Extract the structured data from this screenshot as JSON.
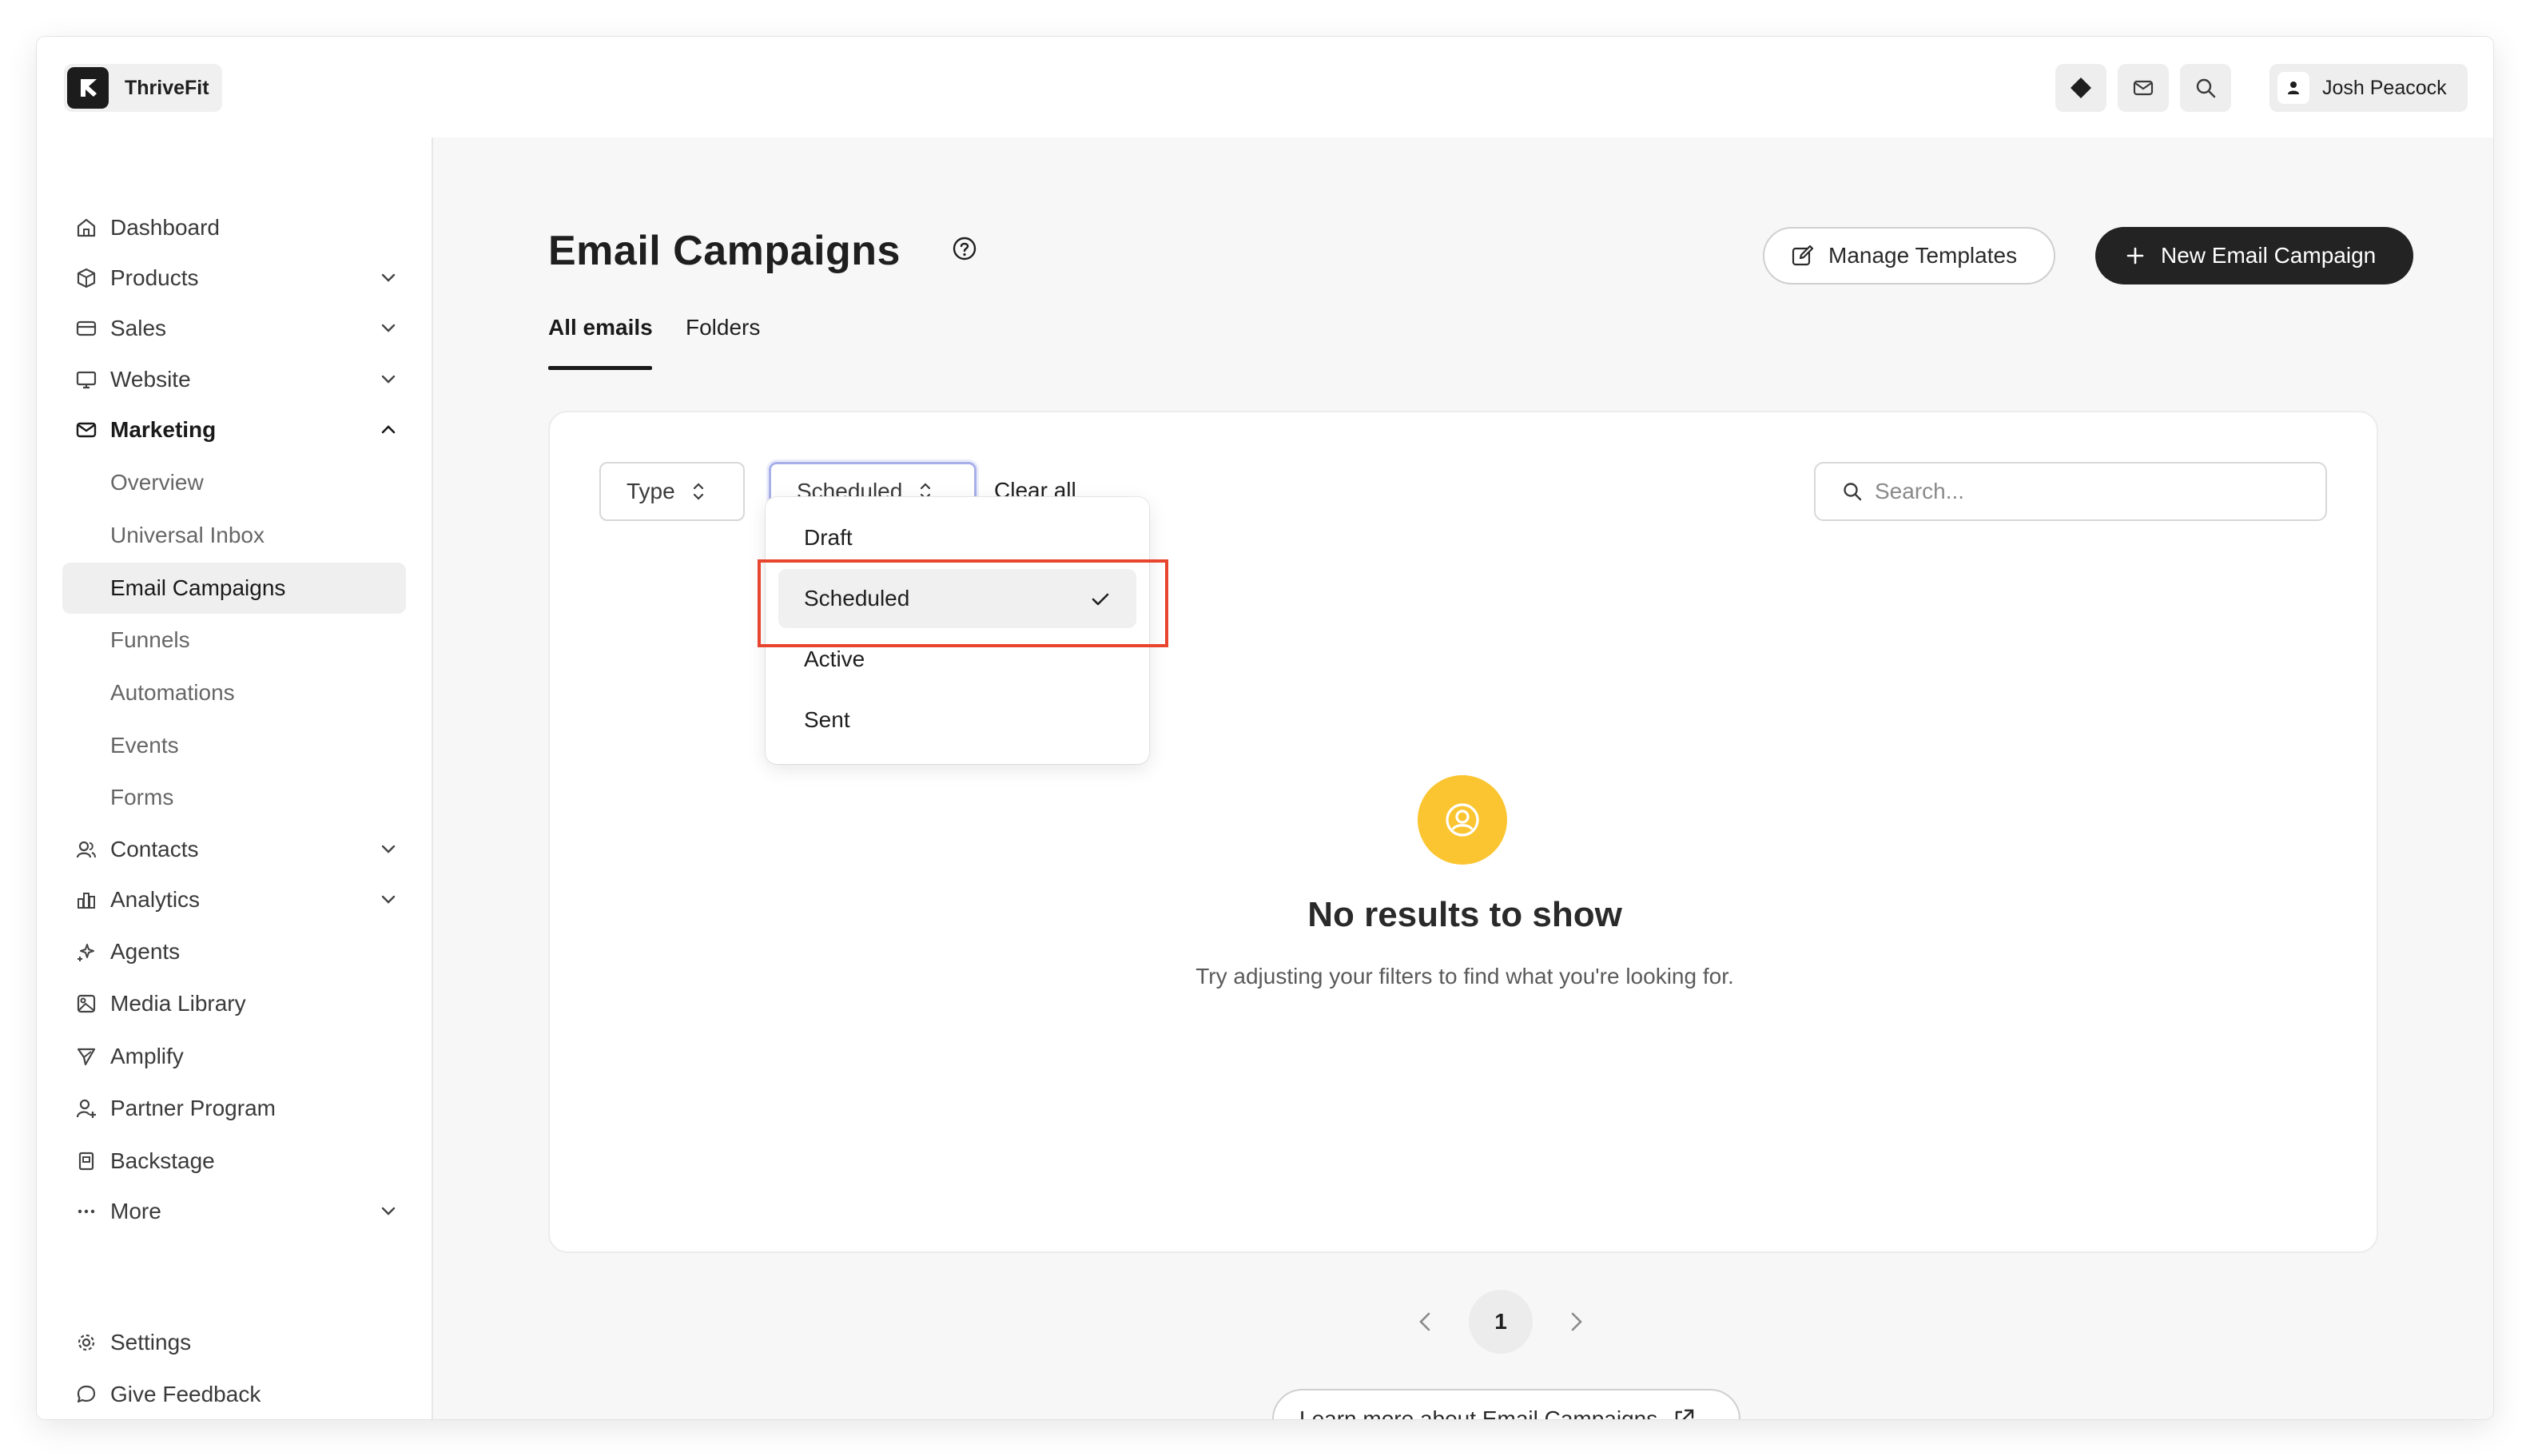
{
  "app": {
    "name": "ThriveFit"
  },
  "header": {
    "user_name": "Josh Peacock"
  },
  "sidebar": {
    "items": [
      {
        "label": "Dashboard"
      },
      {
        "label": "Products"
      },
      {
        "label": "Sales"
      },
      {
        "label": "Website"
      },
      {
        "label": "Marketing"
      },
      {
        "label": "Contacts"
      },
      {
        "label": "Analytics"
      },
      {
        "label": "Agents"
      },
      {
        "label": "Media Library"
      },
      {
        "label": "Amplify"
      },
      {
        "label": "Partner Program"
      },
      {
        "label": "Backstage"
      },
      {
        "label": "More"
      },
      {
        "label": "Settings"
      },
      {
        "label": "Give Feedback"
      }
    ],
    "marketing_sub": [
      {
        "label": "Overview"
      },
      {
        "label": "Universal Inbox"
      },
      {
        "label": "Email Campaigns"
      },
      {
        "label": "Funnels"
      },
      {
        "label": "Automations"
      },
      {
        "label": "Events"
      },
      {
        "label": "Forms"
      }
    ]
  },
  "page": {
    "title": "Email Campaigns",
    "manage_templates": "Manage Templates",
    "new_campaign": "New Email Campaign",
    "tabs": [
      {
        "label": "All emails"
      },
      {
        "label": "Folders"
      }
    ]
  },
  "filters": {
    "type_label": "Type",
    "status_label": "Scheduled",
    "clear_all": "Clear all",
    "search_placeholder": "Search...",
    "options": [
      {
        "label": "Draft"
      },
      {
        "label": "Scheduled"
      },
      {
        "label": "Active"
      },
      {
        "label": "Sent"
      }
    ]
  },
  "empty_state": {
    "title": "No results to show",
    "subtitle": "Try adjusting your filters to find what you're looking for."
  },
  "pagination": {
    "current_page": "1"
  },
  "footer": {
    "learn_more": "Learn more about Email Campaigns"
  },
  "colors": {
    "accent_dark": "#232323",
    "empty_icon_bg": "#fbc531",
    "highlight": "#e8452f",
    "focus_ring": "#a8b0ea"
  }
}
